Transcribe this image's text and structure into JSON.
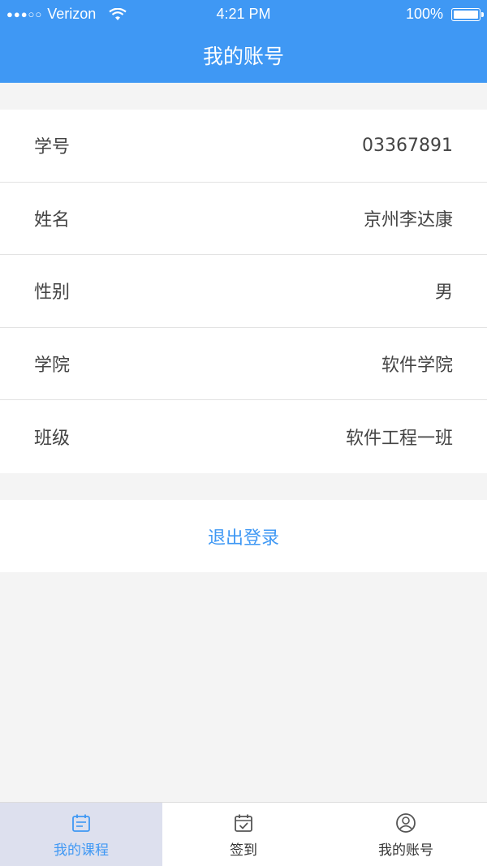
{
  "status_bar": {
    "signal_dots": "●●●○○",
    "carrier": "Verizon",
    "time": "4:21 PM",
    "battery": "100%"
  },
  "header": {
    "title": "我的账号"
  },
  "profile": {
    "rows": [
      {
        "label": "学号",
        "value": "03367891"
      },
      {
        "label": "姓名",
        "value": "京州李达康"
      },
      {
        "label": "性别",
        "value": "男"
      },
      {
        "label": "学院",
        "value": "软件学院"
      },
      {
        "label": "班级",
        "value": "软件工程一班"
      }
    ]
  },
  "logout": {
    "label": "退出登录"
  },
  "tabbar": {
    "tabs": [
      {
        "label": "我的课程",
        "icon": "course-list-icon",
        "active": true
      },
      {
        "label": "签到",
        "icon": "calendar-check-icon",
        "active": false
      },
      {
        "label": "我的账号",
        "icon": "user-circle-icon",
        "active": false
      }
    ]
  },
  "colors": {
    "accent": "#3f98f4",
    "background": "#f4f4f4",
    "active_tab_bg": "#dde0ee"
  }
}
